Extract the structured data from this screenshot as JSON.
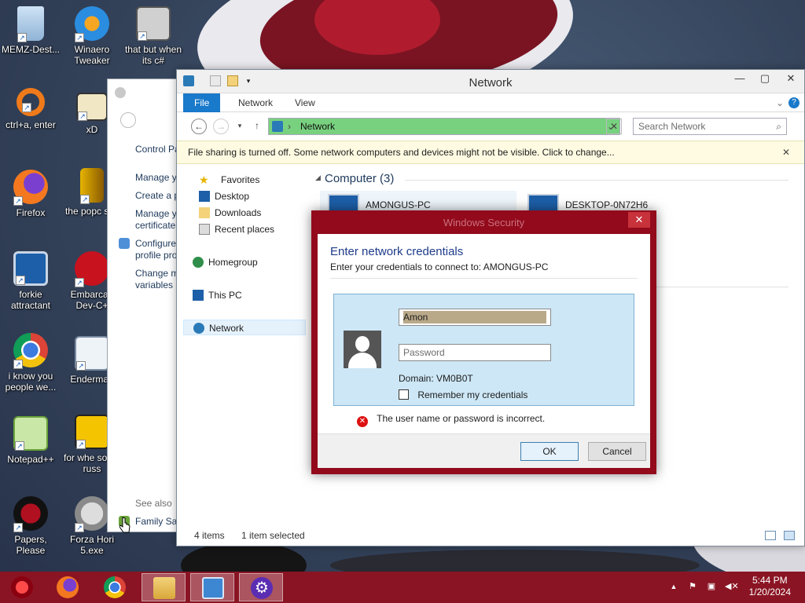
{
  "desktop": {
    "icons": [
      {
        "label": "MEMZ-Dest...",
        "icon": "recycle-bin-icon"
      },
      {
        "label": "Winaero Tweaker",
        "icon": "winaero-icon"
      },
      {
        "label": "that but when its c#",
        "icon": "stacked-windows-icon"
      },
      {
        "label": "ctrl+a, enter",
        "icon": "ring-icon"
      },
      {
        "label": "xD",
        "icon": "hex-editor-icon"
      },
      {
        "label": "Firefox",
        "icon": "firefox-icon"
      },
      {
        "label": "the popc shit",
        "icon": "popcorn-icon"
      },
      {
        "label": "forkie attractant",
        "icon": "settings-monitor-icon"
      },
      {
        "label": "Embarcad Dev-C+",
        "icon": "devcpp-icon"
      },
      {
        "label": "i know you people we...",
        "icon": "chrome-icon"
      },
      {
        "label": "Enderman",
        "icon": "window-icon"
      },
      {
        "label": "Notepad++",
        "icon": "notepadpp-icon"
      },
      {
        "label": "for whe some russ",
        "icon": "dll-icon"
      },
      {
        "label": "Papers, Please",
        "icon": "papers-please-icon"
      },
      {
        "label": "Forza Hori 5.exe",
        "icon": "flash-icon"
      }
    ]
  },
  "control_panel": {
    "items": [
      "Control Pa",
      "Manage y",
      "Create a p",
      "Manage y certificate",
      "Configure profile pro",
      "Change m variables"
    ],
    "see_also": "See also",
    "family": "Family Saf"
  },
  "explorer": {
    "title": "Network",
    "tabs": [
      "File",
      "Network",
      "View"
    ],
    "address": "Network",
    "search_placeholder": "Search Network",
    "infobar": "File sharing is turned off. Some network computers and devices might not be visible. Click to change...",
    "nav": [
      "Favorites",
      "Desktop",
      "Downloads",
      "Recent places",
      "Homegroup",
      "This PC",
      "Network"
    ],
    "group_header": "Computer (3)",
    "computers": [
      "AMONGUS-PC",
      "DESKTOP-0N72H6"
    ],
    "status_items": "4 items",
    "status_selected": "1 item selected"
  },
  "dialog": {
    "title": "Windows Security",
    "heading": "Enter network credentials",
    "subheading": "Enter your credentials to connect to: AMONGUS-PC",
    "username_value": "Amon",
    "password_placeholder": "Password",
    "domain": "Domain: VM0B0T",
    "remember": "Remember my credentials",
    "error": "The user name or password is incorrect.",
    "ok": "OK",
    "cancel": "Cancel"
  },
  "taskbar": {
    "time": "5:44 PM",
    "date": "1/20/2024",
    "apps": [
      "app-icon",
      "firefox-icon",
      "chrome-icon",
      "file-explorer-icon",
      "control-panel-icon",
      "settings-icon"
    ]
  },
  "colors": {
    "accent": "#1979ca",
    "dialog_frame": "#920a1b",
    "taskbar": "#8a1423",
    "address_bar": "#78d17f"
  }
}
